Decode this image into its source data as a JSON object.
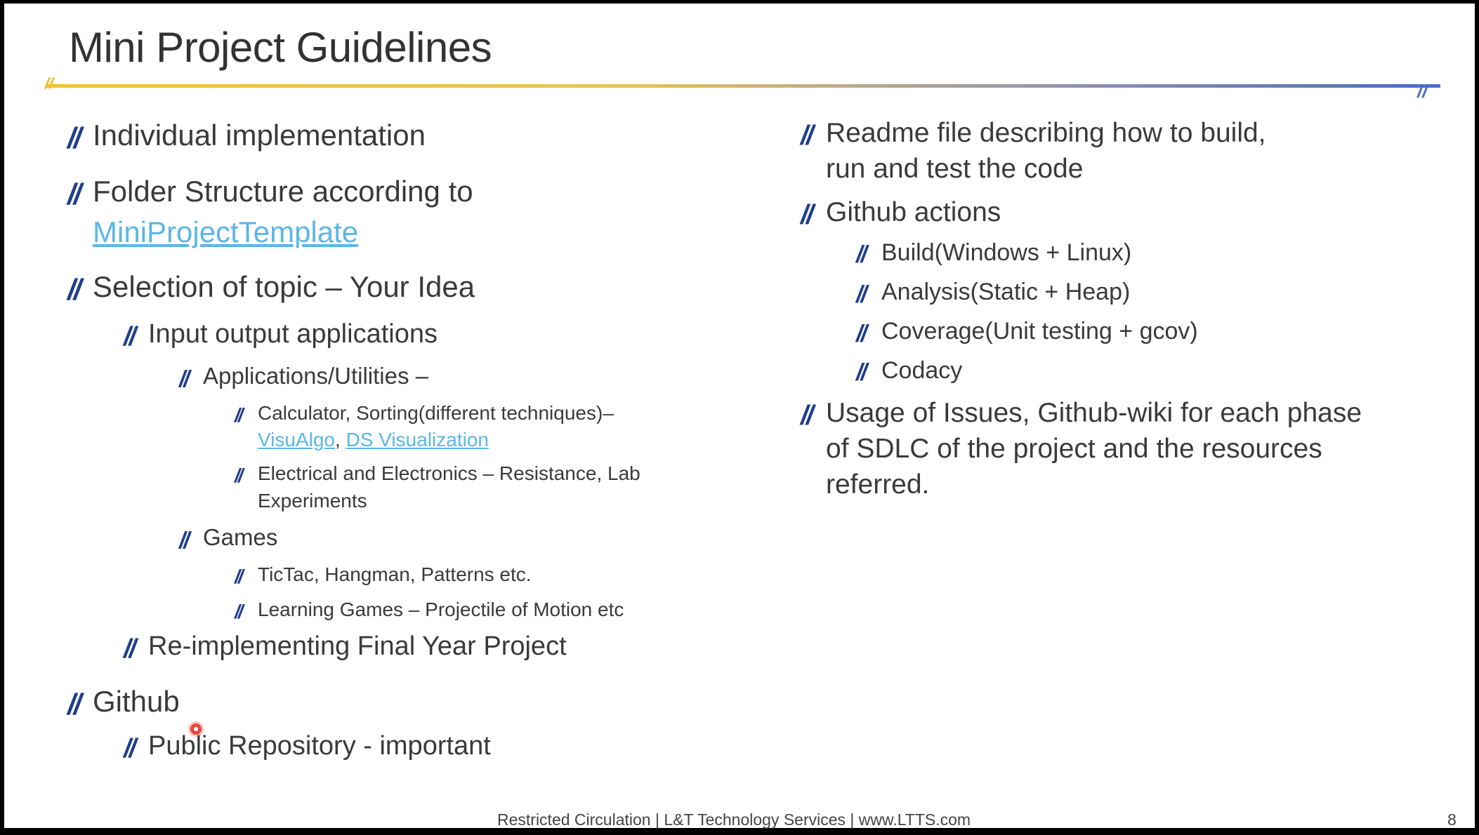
{
  "title": "Mini Project Guidelines",
  "left": [
    {
      "text": "Individual implementation"
    },
    {
      "text": "Folder Structure according to"
    },
    {
      "link": "MiniProjectTemplate"
    },
    {
      "text": "Selection of topic – Your Idea"
    },
    {
      "text": "Input output applications"
    },
    {
      "text": "Applications/Utilities –"
    },
    {
      "text": "Calculator, Sorting(different techniques)–"
    },
    {
      "link1": "VisuAlgo",
      "sep": ", ",
      "link2": "DS Visualization"
    },
    {
      "text": "Electrical and Electronics – Resistance, Lab"
    },
    {
      "text": "Experiments"
    },
    {
      "text": "Games"
    },
    {
      "text": "TicTac, Hangman, Patterns etc."
    },
    {
      "text": "Learning Games – Projectile of Motion etc"
    },
    {
      "text": "Re-implementing Final Year Project"
    },
    {
      "text": "Github"
    },
    {
      "text": "Public Repository - important"
    }
  ],
  "right": [
    {
      "text": "Readme file describing how to build,"
    },
    {
      "text": "run and test the code"
    },
    {
      "text": "Github actions"
    },
    {
      "text": "Build(Windows + Linux)"
    },
    {
      "text": "Analysis(Static + Heap)"
    },
    {
      "text": "Coverage(Unit testing + gcov)"
    },
    {
      "text": "Codacy"
    },
    {
      "text": "Usage of Issues, Github-wiki for each phase"
    },
    {
      "text": "of SDLC of the project and the resources"
    },
    {
      "text": "referred."
    }
  ],
  "bullet": "//",
  "footer": "Restricted Circulation | L&T Technology Services | www.LTTS.com",
  "page_number": "8",
  "colors": {
    "bullet": "#1f3e8c",
    "link": "#5bb6e6",
    "rule_start": "#f2c12e",
    "rule_end": "#4a6cc0"
  }
}
